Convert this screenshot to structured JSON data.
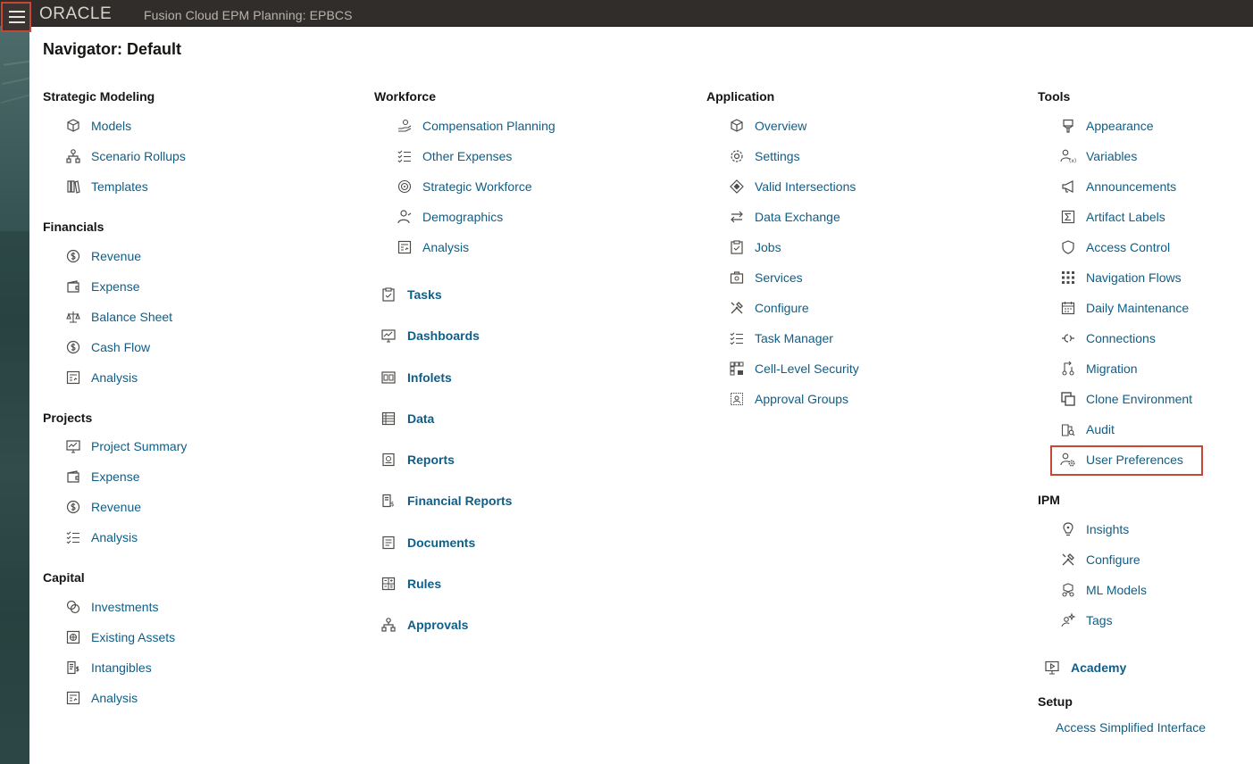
{
  "header": {
    "logo_text": "ORACLE",
    "app_title": "Fusion Cloud EPM Planning:  EPBCS",
    "menu_icon": "hamburger-menu-icon"
  },
  "page": {
    "title": "Navigator: Default"
  },
  "columns": {
    "strategic_modeling": {
      "title": "Strategic Modeling",
      "items": [
        {
          "label": "Models",
          "icon": "cube-icon"
        },
        {
          "label": "Scenario Rollups",
          "icon": "hierarchy-icon"
        },
        {
          "label": "Templates",
          "icon": "books-icon"
        }
      ]
    },
    "financials": {
      "title": "Financials",
      "items": [
        {
          "label": "Revenue",
          "icon": "dollar-circle-icon"
        },
        {
          "label": "Expense",
          "icon": "wallet-icon"
        },
        {
          "label": "Balance Sheet",
          "icon": "scale-icon"
        },
        {
          "label": "Cash Flow",
          "icon": "dollar-circle-icon"
        },
        {
          "label": "Analysis",
          "icon": "analysis-icon"
        }
      ]
    },
    "projects": {
      "title": "Projects",
      "items": [
        {
          "label": "Project Summary",
          "icon": "chart-monitor-icon"
        },
        {
          "label": "Expense",
          "icon": "wallet-icon"
        },
        {
          "label": "Revenue",
          "icon": "dollar-circle-icon"
        },
        {
          "label": "Analysis",
          "icon": "checklist-icon"
        }
      ]
    },
    "capital": {
      "title": "Capital",
      "items": [
        {
          "label": "Investments",
          "icon": "coins-icon"
        },
        {
          "label": "Existing Assets",
          "icon": "asset-icon"
        },
        {
          "label": "Intangibles",
          "icon": "document-dollar-icon"
        },
        {
          "label": "Analysis",
          "icon": "analysis-icon"
        }
      ]
    },
    "workforce": {
      "title": "Workforce",
      "items": [
        {
          "label": "Compensation Planning",
          "icon": "hand-coin-icon"
        },
        {
          "label": "Other Expenses",
          "icon": "checklist-icon"
        },
        {
          "label": "Strategic Workforce",
          "icon": "target-icon"
        },
        {
          "label": "Demographics",
          "icon": "person-icon"
        },
        {
          "label": "Analysis",
          "icon": "analysis-icon"
        }
      ]
    },
    "cards": [
      {
        "label": "Tasks",
        "icon": "clipboard-icon"
      },
      {
        "label": "Dashboards",
        "icon": "chart-monitor-icon"
      },
      {
        "label": "Infolets",
        "icon": "infolet-icon"
      },
      {
        "label": "Data",
        "icon": "table-icon"
      },
      {
        "label": "Reports",
        "icon": "report-icon"
      },
      {
        "label": "Financial Reports",
        "icon": "financial-report-icon"
      },
      {
        "label": "Documents",
        "icon": "document-icon"
      },
      {
        "label": "Rules",
        "icon": "calculator-icon"
      },
      {
        "label": "Approvals",
        "icon": "hierarchy-icon"
      }
    ],
    "application": {
      "title": "Application",
      "items": [
        {
          "label": "Overview",
          "icon": "cube-icon"
        },
        {
          "label": "Settings",
          "icon": "gear-icon"
        },
        {
          "label": "Valid Intersections",
          "icon": "intersect-icon"
        },
        {
          "label": "Data Exchange",
          "icon": "exchange-icon"
        },
        {
          "label": "Jobs",
          "icon": "clipboard-icon"
        },
        {
          "label": "Services",
          "icon": "briefcase-icon"
        },
        {
          "label": "Configure",
          "icon": "tools-icon"
        },
        {
          "label": "Task Manager",
          "icon": "checklist-icon"
        },
        {
          "label": "Cell-Level Security",
          "icon": "grid-lock-icon"
        },
        {
          "label": "Approval Groups",
          "icon": "group-icon"
        }
      ]
    },
    "tools": {
      "title": "Tools",
      "items": [
        {
          "label": "Appearance",
          "icon": "brush-icon"
        },
        {
          "label": "Variables",
          "icon": "person-variable-icon"
        },
        {
          "label": "Announcements",
          "icon": "megaphone-icon"
        },
        {
          "label": "Artifact Labels",
          "icon": "sigma-icon"
        },
        {
          "label": "Access Control",
          "icon": "shield-icon"
        },
        {
          "label": "Navigation Flows",
          "icon": "grid-dots-icon"
        },
        {
          "label": "Daily Maintenance",
          "icon": "calendar-icon"
        },
        {
          "label": "Connections",
          "icon": "connection-icon"
        },
        {
          "label": "Migration",
          "icon": "migration-icon"
        },
        {
          "label": "Clone Environment",
          "icon": "clone-icon"
        },
        {
          "label": "Audit",
          "icon": "audit-icon"
        },
        {
          "label": "User Preferences",
          "icon": "user-gear-icon"
        }
      ]
    },
    "ipm": {
      "title": "IPM",
      "items": [
        {
          "label": "Insights",
          "icon": "lightbulb-icon"
        },
        {
          "label": "Configure",
          "icon": "tools-icon"
        },
        {
          "label": "ML Models",
          "icon": "ml-icon"
        },
        {
          "label": "Tags",
          "icon": "sparkle-person-icon"
        }
      ]
    },
    "academy": {
      "label": "Academy",
      "icon": "play-monitor-icon"
    },
    "setup": {
      "title": "Setup",
      "link": "Access Simplified Interface"
    }
  },
  "colors": {
    "link": "#0e5e88",
    "header_bg": "#312d2a",
    "highlight": "#c74634"
  }
}
